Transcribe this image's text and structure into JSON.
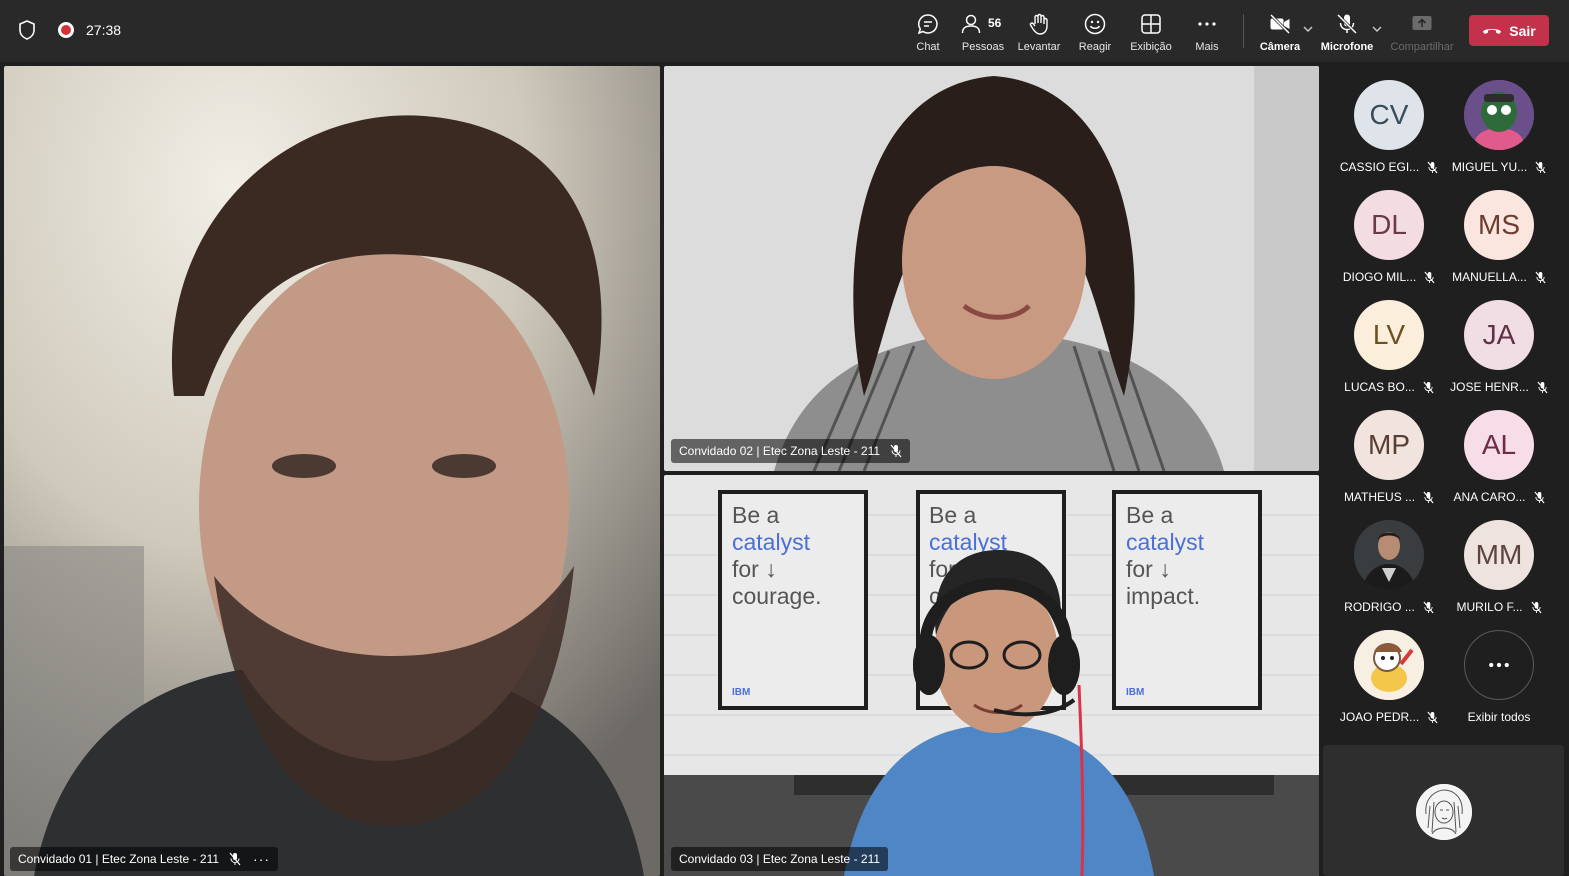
{
  "header": {
    "timer": "27:38",
    "toolbar": {
      "chat": "Chat",
      "people": "Pessoas",
      "people_count": "56",
      "raise": "Levantar",
      "react": "Reagir",
      "view": "Exibição",
      "more": "Mais",
      "camera": "Câmera",
      "mic": "Microfone",
      "share": "Compartilhar",
      "leave": "Sair"
    }
  },
  "tiles": [
    {
      "name": "Convidado 01 | Etec Zona Leste - 211"
    },
    {
      "name": "Convidado 02 | Etec Zona Leste - 211"
    },
    {
      "name": "Convidado 03 | Etec Zona Leste - 211"
    }
  ],
  "poster_text": {
    "be_a": "Be a",
    "catalyst": "catalyst",
    "for": "for ↓",
    "courage": "courage.",
    "impact": "impact.",
    "cr": "cr",
    "for_short": "for",
    "brand": "IBM"
  },
  "roster": {
    "participants": [
      {
        "initials": "CV",
        "name": "CASSIO EGI...",
        "bg": "#dfe3ea",
        "fg": "#394c5c"
      },
      {
        "initials": "",
        "name": "MIGUEL YU...",
        "bg": "#6b4f8a",
        "fg": "#ffffff"
      },
      {
        "initials": "DL",
        "name": "DIOGO MIL...",
        "bg": "#f3dde2",
        "fg": "#6b3a48"
      },
      {
        "initials": "MS",
        "name": "MANUELLA...",
        "bg": "#fbe6df",
        "fg": "#6d3b2f"
      },
      {
        "initials": "LV",
        "name": "LUCAS BO...",
        "bg": "#fbeedb",
        "fg": "#6d5020"
      },
      {
        "initials": "JA",
        "name": "JOSE HENR...",
        "bg": "#f1dde4",
        "fg": "#5e3246"
      },
      {
        "initials": "MP",
        "name": "MATHEUS ...",
        "bg": "#f1e4de",
        "fg": "#5a3e33"
      },
      {
        "initials": "AL",
        "name": "ANA CARO...",
        "bg": "#f7dde8",
        "fg": "#6b2d47"
      },
      {
        "initials": "",
        "name": "RODRIGO ...",
        "bg": "#2a2a2a",
        "fg": "#ffffff"
      },
      {
        "initials": "MM",
        "name": "MURILO F...",
        "bg": "#efe3e0",
        "fg": "#5c4540"
      },
      {
        "initials": "",
        "name": "JOAO PEDR...",
        "bg": "#f7efe2",
        "fg": "#333333"
      }
    ],
    "show_all": "Exibir todos"
  }
}
